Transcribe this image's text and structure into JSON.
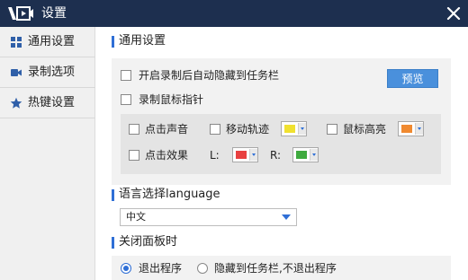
{
  "window": {
    "title": "设置",
    "logo_icon": "video-recorder-logo",
    "close_icon": "close-x"
  },
  "sidebar": {
    "items": [
      {
        "label": "通用设置",
        "icon": "grid-squares",
        "selected": true
      },
      {
        "label": "录制选项",
        "icon": "video-camera",
        "selected": false
      },
      {
        "label": "热键设置",
        "icon": "star",
        "selected": false
      }
    ]
  },
  "general": {
    "title": "通用设置",
    "auto_hide_label": "开启录制后自动隐藏到任务栏",
    "auto_hide_checked": false,
    "preview_label": "预览",
    "record_cursor_label": "录制鼠标指针",
    "record_cursor_checked": false,
    "click_sound_label": "点击声音",
    "click_sound_checked": false,
    "move_track_label": "移动轨迹",
    "move_track_checked": false,
    "move_track_color": "#f0e130",
    "highlight_label": "鼠标高亮",
    "highlight_checked": false,
    "highlight_color": "#f08a30",
    "click_effect_label": "点击效果",
    "click_effect_checked": false,
    "left_label": "L:",
    "left_color": "#e84040",
    "right_label": "R:",
    "right_color": "#3faa3f"
  },
  "language": {
    "title": "语言选择language",
    "selected": "中文"
  },
  "close_panel": {
    "title": "关闭面板时",
    "exit_label": "退出程序",
    "exit_selected": true,
    "hide_label": "隐藏到任务栏,不退出程序",
    "hide_selected": false
  },
  "colors": {
    "titlebar": "#1d2f4f",
    "accent": "#2f6fd6",
    "button": "#4a90dc"
  }
}
